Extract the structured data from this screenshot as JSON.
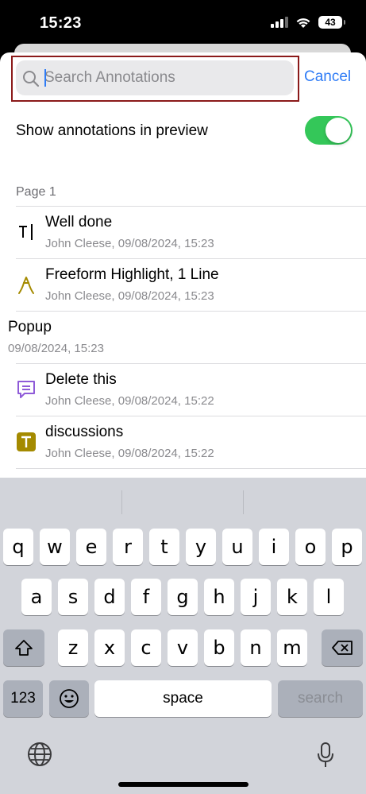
{
  "status_bar": {
    "time": "15:23",
    "battery": "43"
  },
  "search": {
    "placeholder": "Search Annotations",
    "value": "",
    "cancel_label": "Cancel"
  },
  "preview_toggle": {
    "label": "Show annotations in preview",
    "on": true
  },
  "section": {
    "header": "Page 1"
  },
  "annotations": [
    {
      "title": "Well done",
      "subtitle": "John Cleese, 09/08/2024, 15:23",
      "icon": "text-cursor-icon"
    },
    {
      "title": "Freeform Highlight, 1 Line",
      "subtitle": "John Cleese, 09/08/2024, 15:23",
      "icon": "freeform-highlight-icon"
    },
    {
      "title": "Popup",
      "subtitle": "09/08/2024, 15:23",
      "icon": ""
    },
    {
      "title": "Delete this",
      "subtitle": "John Cleese, 09/08/2024, 15:22",
      "icon": "comment-icon"
    },
    {
      "title": "discussions",
      "subtitle": "John Cleese, 09/08/2024, 15:22",
      "icon": "text-box-icon"
    }
  ],
  "colors": {
    "accent": "#2f7cf6",
    "toggle_on": "#34c759",
    "highlight_icon": "#a48a00",
    "comment_icon": "#8f5bd8",
    "text_box_icon": "#a48a00",
    "focus_outline": "#8b1a1a"
  },
  "keyboard": {
    "row1": [
      "q",
      "w",
      "e",
      "r",
      "t",
      "y",
      "u",
      "i",
      "o",
      "p"
    ],
    "row2": [
      "a",
      "s",
      "d",
      "f",
      "g",
      "h",
      "j",
      "k",
      "l"
    ],
    "row3": [
      "z",
      "x",
      "c",
      "v",
      "b",
      "n",
      "m"
    ],
    "numbers_label": "123",
    "space_label": "space",
    "search_label": "search"
  }
}
